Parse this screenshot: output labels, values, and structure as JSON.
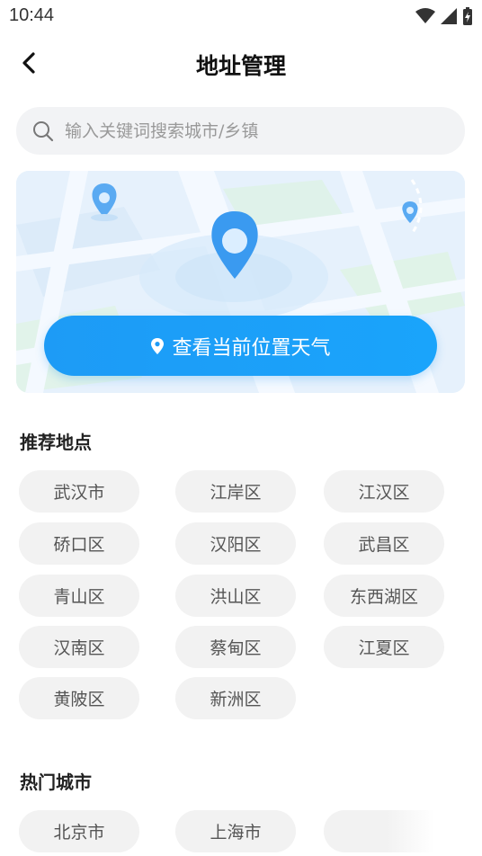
{
  "status_bar": {
    "time": "10:44"
  },
  "header": {
    "title": "地址管理"
  },
  "search": {
    "placeholder": "输入关键词搜索城市/乡镇"
  },
  "locate": {
    "label": "查看当前位置天气"
  },
  "recommended": {
    "title": "推荐地点",
    "items": [
      "武汉市",
      "江岸区",
      "江汉区",
      "硚口区",
      "汉阳区",
      "武昌区",
      "青山区",
      "洪山区",
      "东西湖区",
      "汉南区",
      "蔡甸区",
      "江夏区",
      "黄陂区",
      "新洲区"
    ]
  },
  "hot_cities": {
    "title": "热门城市",
    "items": [
      "北京市",
      "上海市"
    ]
  },
  "colors": {
    "accent": "#1a9ff8",
    "chip_bg": "#f2f2f2"
  }
}
